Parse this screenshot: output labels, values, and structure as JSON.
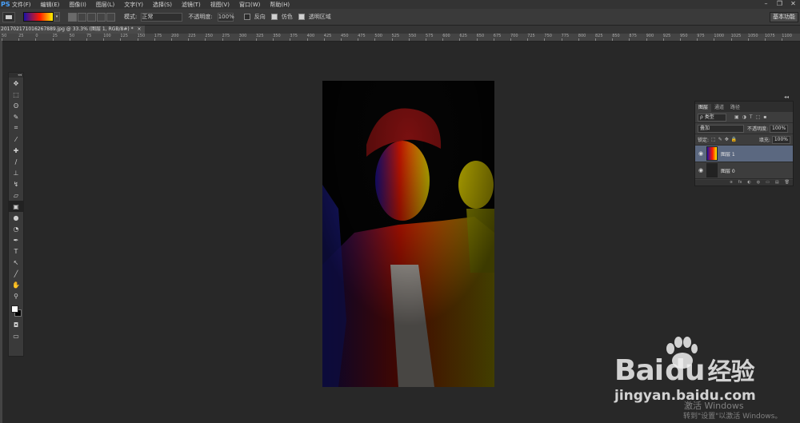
{
  "app": {
    "logo": "PS"
  },
  "menu": {
    "items": [
      "文件(F)",
      "编辑(E)",
      "图像(I)",
      "图层(L)",
      "文字(Y)",
      "选择(S)",
      "滤镜(T)",
      "视图(V)",
      "窗口(W)",
      "帮助(H)"
    ]
  },
  "window_controls": {
    "minimize": "–",
    "restore": "❐",
    "close": "✕"
  },
  "options": {
    "mode_label": "模式:",
    "mode_value": "正常",
    "opacity_label": "不透明度:",
    "opacity_value": "100%",
    "reverse_label": "反向",
    "dither_label": "仿色",
    "transparency_label": "透明区域",
    "reverse_checked": false,
    "dither_checked": true,
    "transparency_checked": true,
    "workspace": "基本功能"
  },
  "document": {
    "tab_title": "201702171016267889.jpg @ 33.3% (图层 1, RGB/8#) *",
    "close": "×"
  },
  "ruler": {
    "labels": [
      "50",
      "25",
      "0",
      "25",
      "50",
      "75",
      "100",
      "125",
      "150",
      "175",
      "200",
      "225",
      "250",
      "275",
      "300",
      "325",
      "350",
      "375",
      "400",
      "425",
      "450",
      "475",
      "500",
      "525",
      "550",
      "575",
      "600",
      "625",
      "650",
      "675",
      "700",
      "725",
      "750",
      "775",
      "800",
      "825",
      "850",
      "875",
      "900",
      "925",
      "950",
      "975",
      "1000",
      "1025",
      "1050",
      "1075",
      "1100"
    ]
  },
  "tools": {
    "grip": "◂◂",
    "items": [
      {
        "icon": "move-icon",
        "glyph": "✥"
      },
      {
        "icon": "marquee-icon",
        "glyph": "⬚"
      },
      {
        "icon": "lasso-icon",
        "glyph": "ʘ"
      },
      {
        "icon": "quick-select-icon",
        "glyph": "✎"
      },
      {
        "icon": "crop-icon",
        "glyph": "⌗"
      },
      {
        "icon": "eyedropper-icon",
        "glyph": "⁄"
      },
      {
        "icon": "healing-icon",
        "glyph": "✚"
      },
      {
        "icon": "brush-icon",
        "glyph": "∕"
      },
      {
        "icon": "stamp-icon",
        "glyph": "⊥"
      },
      {
        "icon": "history-brush-icon",
        "glyph": "↯"
      },
      {
        "icon": "eraser-icon",
        "glyph": "▱"
      },
      {
        "icon": "gradient-icon",
        "glyph": "▣"
      },
      {
        "icon": "blur-icon",
        "glyph": "●"
      },
      {
        "icon": "dodge-icon",
        "glyph": "◔"
      },
      {
        "icon": "pen-icon",
        "glyph": "✒"
      },
      {
        "icon": "type-icon",
        "glyph": "T"
      },
      {
        "icon": "path-select-icon",
        "glyph": "↖"
      },
      {
        "icon": "line-icon",
        "glyph": "╱"
      },
      {
        "icon": "hand-icon",
        "glyph": "✋"
      },
      {
        "icon": "zoom-icon",
        "glyph": "⚲"
      }
    ],
    "extra": [
      {
        "icon": "quick-mask-icon",
        "glyph": "◘"
      },
      {
        "icon": "screen-mode-icon",
        "glyph": "▭"
      }
    ]
  },
  "layers_panel": {
    "collapse": "◂◂",
    "tabs": [
      "图层",
      "通道",
      "路径"
    ],
    "filter_label": "ρ 类型",
    "blend_mode": "叠加",
    "opacity_label": "不透明度:",
    "opacity_value": "100%",
    "lock_label": "锁定:",
    "fill_label": "填充:",
    "fill_value": "100%",
    "layers": [
      {
        "name": "图层 1",
        "selected": true,
        "visible": true
      },
      {
        "name": "图层 0",
        "selected": false,
        "visible": true
      }
    ],
    "bottom_icons": [
      "ɞ",
      "fx",
      "◐",
      "◍",
      "▭",
      "▤",
      "🗑"
    ]
  },
  "watermark": {
    "logo_main": "Bai",
    "logo_du": "du",
    "logo_cn": "经验",
    "url": "jingyan.baidu.com",
    "activation_title": "激活 Windows",
    "activation_sub": "转到\"设置\"以激活 Windows。"
  },
  "colors": {
    "accent": "#4aa3ff",
    "selected_layer": "#5b6880",
    "canvas_bg": "#282828"
  }
}
